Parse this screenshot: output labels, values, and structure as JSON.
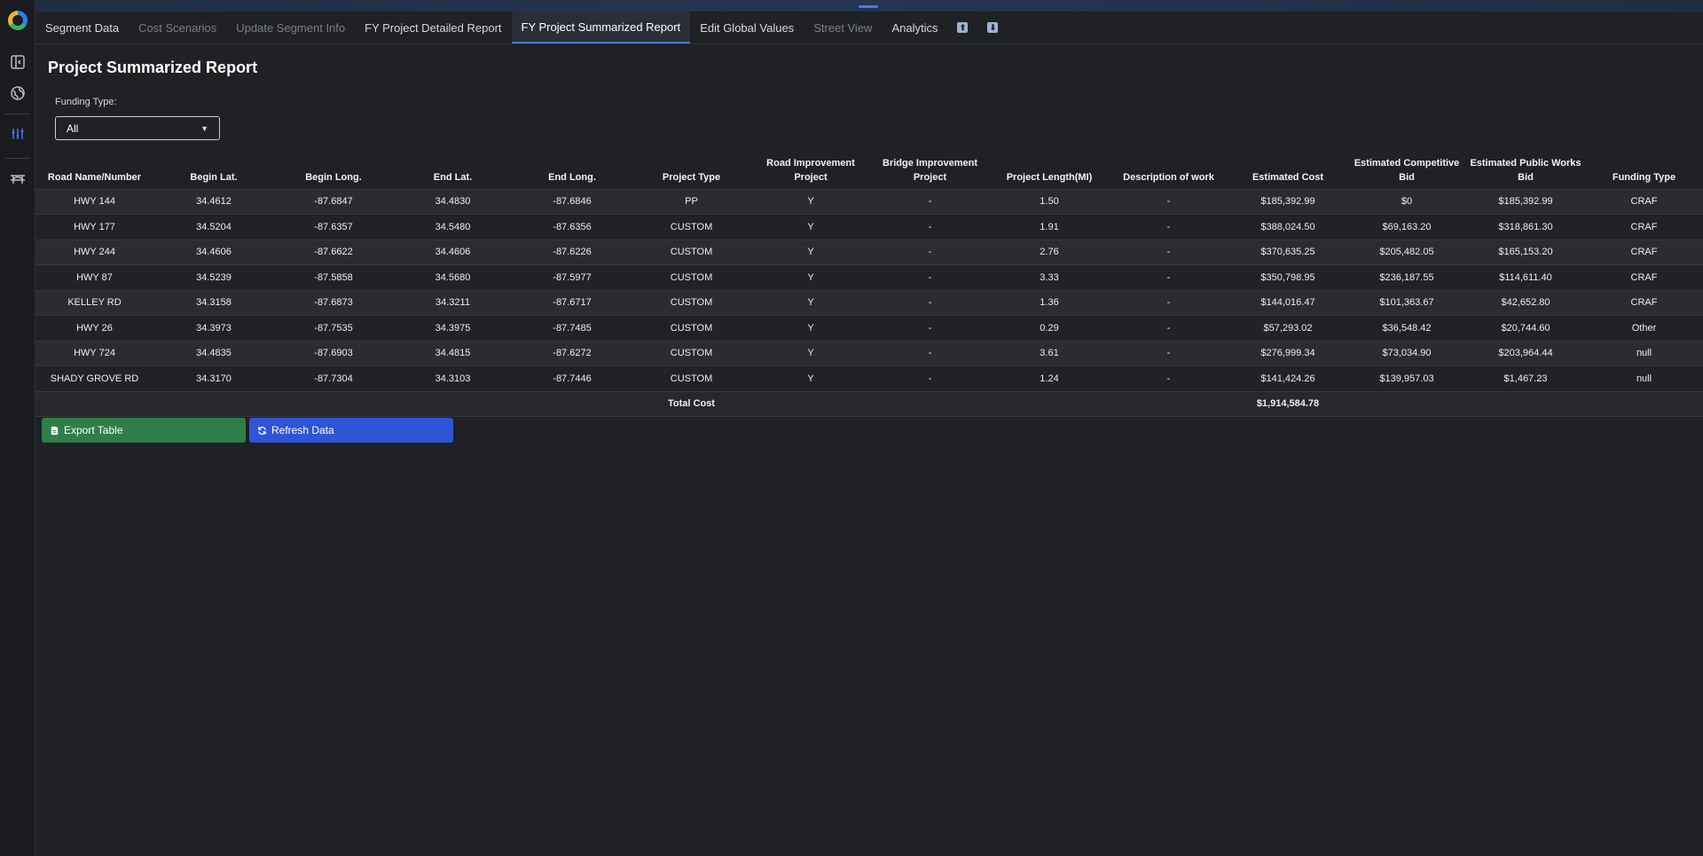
{
  "tabs": [
    {
      "label": "Segment Data",
      "state": "normal"
    },
    {
      "label": "Cost Scenarios",
      "state": "disabled"
    },
    {
      "label": "Update Segment Info",
      "state": "disabled"
    },
    {
      "label": "FY Project Detailed Report",
      "state": "normal"
    },
    {
      "label": "FY Project Summarized Report",
      "state": "active"
    },
    {
      "label": "Edit Global Values",
      "state": "normal"
    },
    {
      "label": "Street View",
      "state": "disabled"
    },
    {
      "label": "Analytics",
      "state": "normal"
    }
  ],
  "tab_icons": [
    "upload-icon",
    "download-icon"
  ],
  "sidebar": {
    "icons": [
      "app-logo-icon",
      "sidebar-toggle-icon",
      "globe-icon",
      "report-icon",
      "bridge-icon"
    ]
  },
  "page": {
    "title": "Project Summarized Report",
    "filter_label": "Funding Type:",
    "filter_value": "All"
  },
  "table": {
    "headers": [
      "Road Name/Number",
      "Begin Lat.",
      "Begin Long.",
      "End Lat.",
      "End Long.",
      "Project Type",
      "Road Improvement Project",
      "Bridge Improvement Project",
      "Project Length(MI)",
      "Description of work",
      "Estimated Cost",
      "Estimated Competitive Bid",
      "Estimated Public Works Bid",
      "Funding Type"
    ],
    "rows": [
      [
        "HWY 144",
        "34.4612",
        "-87.6847",
        "34.4830",
        "-87.6846",
        "PP",
        "Y",
        "-",
        "1.50",
        "-",
        "$185,392.99",
        "$0",
        "$185,392.99",
        "CRAF"
      ],
      [
        "HWY 177",
        "34.5204",
        "-87.6357",
        "34.5480",
        "-87.6356",
        "CUSTOM",
        "Y",
        "-",
        "1.91",
        "-",
        "$388,024.50",
        "$69,163.20",
        "$318,861.30",
        "CRAF"
      ],
      [
        "HWY 244",
        "34.4606",
        "-87.6622",
        "34.4606",
        "-87.6226",
        "CUSTOM",
        "Y",
        "-",
        "2.76",
        "-",
        "$370,635.25",
        "$205,482.05",
        "$165,153.20",
        "CRAF"
      ],
      [
        "HWY 87",
        "34.5239",
        "-87.5858",
        "34.5680",
        "-87.5977",
        "CUSTOM",
        "Y",
        "-",
        "3.33",
        "-",
        "$350,798.95",
        "$236,187.55",
        "$114,611.40",
        "CRAF"
      ],
      [
        "KELLEY RD",
        "34.3158",
        "-87.6873",
        "34.3211",
        "-87.6717",
        "CUSTOM",
        "Y",
        "-",
        "1.36",
        "-",
        "$144,016.47",
        "$101,363.67",
        "$42,652.80",
        "CRAF"
      ],
      [
        "HWY 26",
        "34.3973",
        "-87.7535",
        "34.3975",
        "-87.7485",
        "CUSTOM",
        "Y",
        "-",
        "0.29",
        "-",
        "$57,293.02",
        "$36,548.42",
        "$20,744.60",
        "Other"
      ],
      [
        "HWY 724",
        "34.4835",
        "-87.6903",
        "34.4815",
        "-87.6272",
        "CUSTOM",
        "Y",
        "-",
        "3.61",
        "-",
        "$276,999.34",
        "$73,034.90",
        "$203,964.44",
        "null"
      ],
      [
        "SHADY GROVE RD",
        "34.3170",
        "-87.7304",
        "34.3103",
        "-87.7446",
        "CUSTOM",
        "Y",
        "-",
        "1.24",
        "-",
        "$141,424.26",
        "$139,957.03",
        "$1,467.23",
        "null"
      ]
    ],
    "total_label": "Total Cost",
    "total_value": "$1,914,584.78"
  },
  "buttons": {
    "export": "Export Table",
    "refresh": "Refresh Data"
  },
  "colors": {
    "accent": "#4d74ff",
    "export_button": "#2f7e4a",
    "refresh_button": "#2f54d6",
    "background": "#1f2124"
  }
}
